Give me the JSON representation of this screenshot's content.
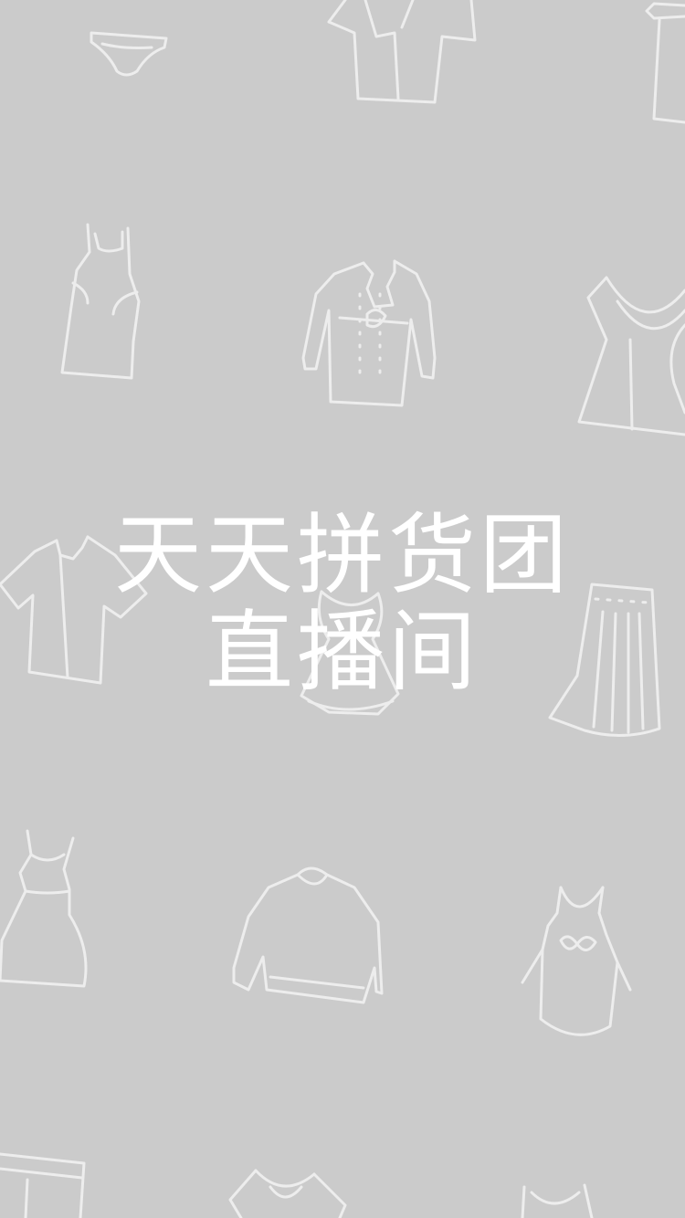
{
  "splash": {
    "title_line1": "天天拼货团",
    "title_line2": "直播间"
  },
  "theme": {
    "background": "#cbcbcb",
    "icon_stroke": "#ededed",
    "title_color": "#ffffff"
  },
  "decor_icons": [
    "underwear-icon",
    "robe-icon",
    "door-hanger-icon",
    "apron-dress-icon",
    "coat-icon",
    "ruffle-top-icon",
    "shirt-icon",
    "bodice-icon",
    "skirt-icon",
    "dress-icon",
    "sweater-icon",
    "apron-icon",
    "pants-icon",
    "blouse-icon",
    "tank-top-icon"
  ]
}
